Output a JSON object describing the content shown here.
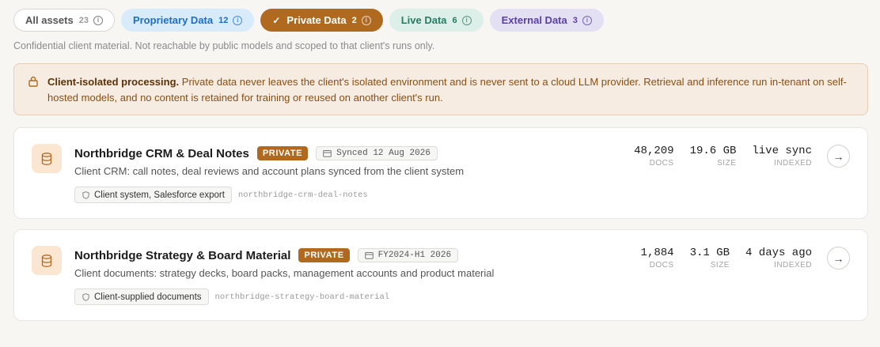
{
  "tabs": [
    {
      "label": "All assets",
      "count": "23"
    },
    {
      "label": "Proprietary Data",
      "count": "12"
    },
    {
      "label": "Private Data",
      "count": "2"
    },
    {
      "label": "Live Data",
      "count": "6"
    },
    {
      "label": "External Data",
      "count": "3"
    }
  ],
  "subtitle": "Confidential client material. Not reachable by public models and scoped to that client's runs only.",
  "notice": {
    "heading": "Client-isolated processing.",
    "body": "Private data never leaves the client's isolated environment and is never sent to a cloud LLM provider. Retrieval and inference run in-tenant on self-hosted models, and no content is retained for training or reused on another client's run."
  },
  "cards": [
    {
      "title": "Northbridge CRM & Deal Notes",
      "badge": "PRIVATE",
      "meta": "Synced 12 Aug 2026",
      "description": "Client CRM: call notes, deal reviews and account plans synced from the client system",
      "source": "Client system, Salesforce export",
      "slug": "northbridge-crm-deal-notes",
      "stats": [
        {
          "value": "48,209",
          "label": "DOCS"
        },
        {
          "value": "19.6 GB",
          "label": "SIZE"
        },
        {
          "value": "live sync",
          "label": "INDEXED"
        }
      ],
      "arrow": "→"
    },
    {
      "title": "Northbridge Strategy & Board Material",
      "badge": "PRIVATE",
      "meta": "FY2024-H1 2026",
      "description": "Client documents: strategy decks, board packs, management accounts and product material",
      "source": "Client-supplied documents",
      "slug": "northbridge-strategy-board-material",
      "stats": [
        {
          "value": "1,884",
          "label": "DOCS"
        },
        {
          "value": "3.1 GB",
          "label": "SIZE"
        },
        {
          "value": "4 days ago",
          "label": "INDEXED"
        }
      ],
      "arrow": "→"
    }
  ],
  "icons": {
    "check": "✓",
    "info": "i"
  }
}
